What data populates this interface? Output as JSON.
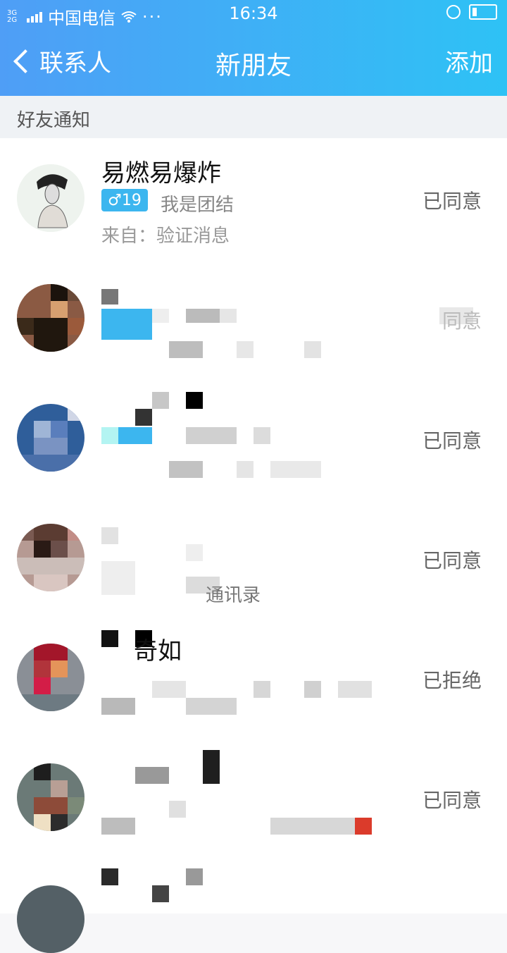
{
  "statusbar": {
    "network": "3G\n2G",
    "carrier": "中国电信",
    "dots": "···",
    "time": "16:34"
  },
  "nav": {
    "back_label": "联系人",
    "title": "新朋友",
    "add_label": "添加"
  },
  "section": {
    "title": "好友通知"
  },
  "items": [
    {
      "name": "易燃易爆炸",
      "badge": "♂19",
      "message": "我是团结",
      "source": "来自：验证消息",
      "status": "已同意"
    },
    {
      "status": "同意"
    },
    {
      "status": "已同意"
    },
    {
      "source_partial": "通讯录",
      "status": "已同意"
    },
    {
      "name_partial": "奇如",
      "status": "已拒绝"
    },
    {
      "status": "已同意"
    }
  ],
  "colors": {
    "header_start": "#4f9ef6",
    "header_end": "#2ec2f5",
    "badge": "#3cb6ef"
  },
  "icons": {
    "back": "chevron-left-icon",
    "wifi": "wifi-icon",
    "alarm": "alarm-icon",
    "battery": "battery-icon"
  }
}
